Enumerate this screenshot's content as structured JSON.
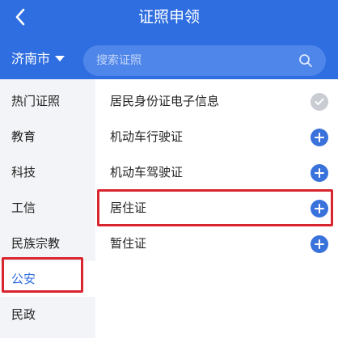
{
  "header": {
    "title": "证照申领"
  },
  "city": {
    "label": "济南市"
  },
  "search": {
    "placeholder": "搜索证照"
  },
  "sidebar": {
    "items": [
      {
        "label": "热门证照"
      },
      {
        "label": "教育"
      },
      {
        "label": "科技"
      },
      {
        "label": "工信"
      },
      {
        "label": "民族宗教"
      },
      {
        "label": "公安"
      },
      {
        "label": "民政"
      }
    ],
    "active": "公安"
  },
  "list": {
    "items": [
      {
        "label": "居民身份证电子信息",
        "action": "check-icon"
      },
      {
        "label": "机动车行驶证",
        "action": "plus-icon"
      },
      {
        "label": "机动车驾驶证",
        "action": "plus-icon"
      },
      {
        "label": "居住证",
        "action": "plus-icon"
      },
      {
        "label": "暂住证",
        "action": "plus-icon"
      }
    ]
  },
  "colors": {
    "primary": "#2f6ee0",
    "highlight": "#d9252f",
    "sidebar_bg": "#f3f4f7"
  }
}
